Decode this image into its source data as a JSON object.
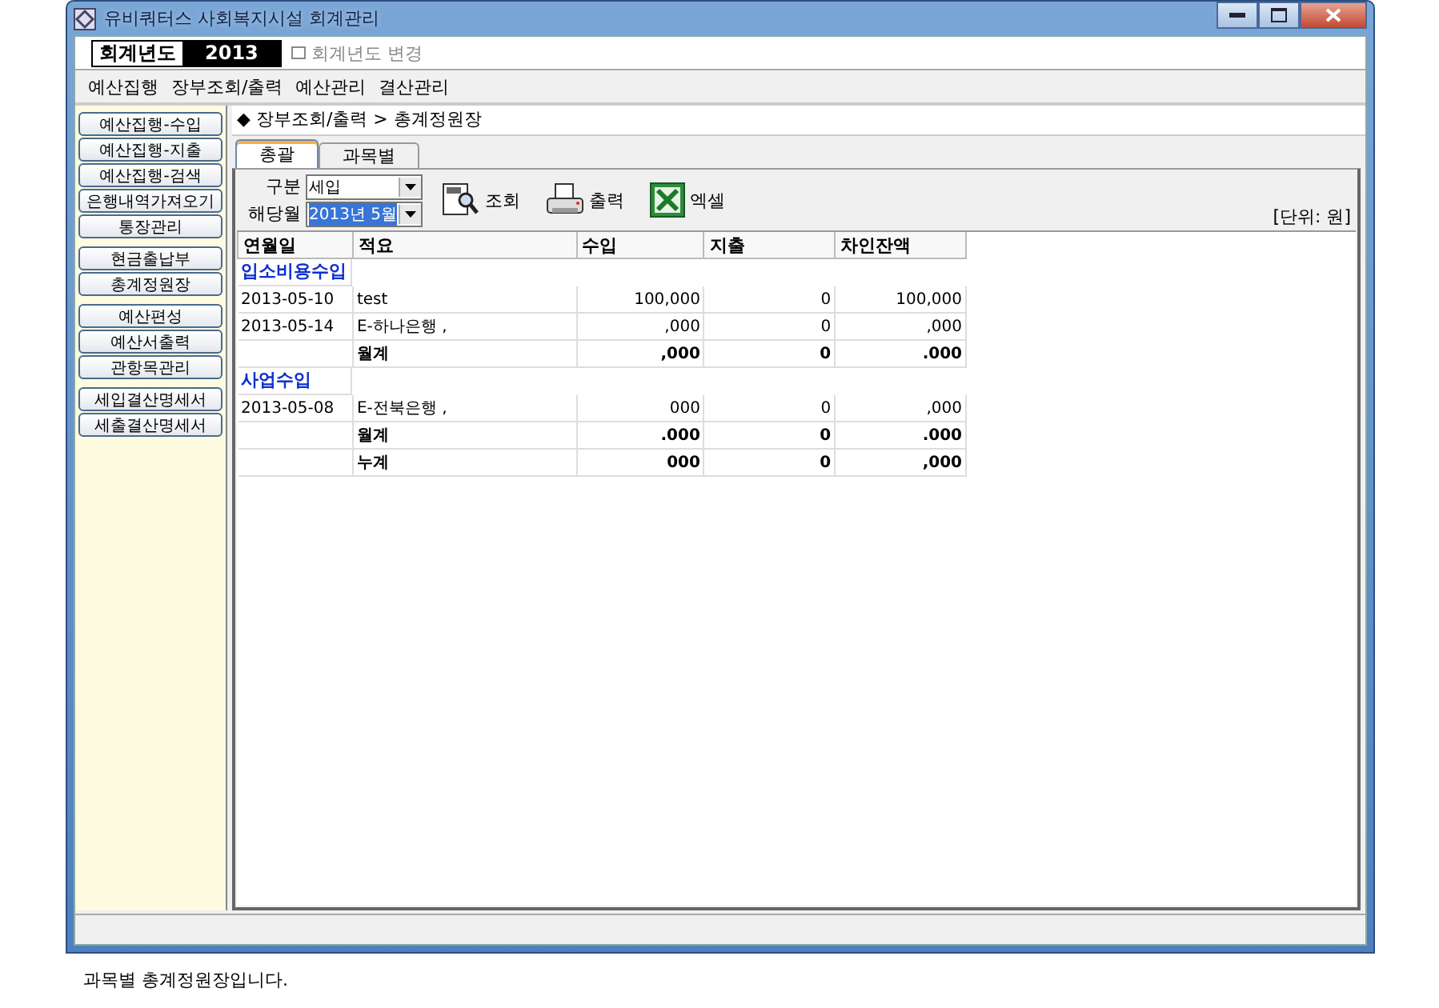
{
  "window": {
    "title": "유비쿼터스 사회복지시설 회계관리"
  },
  "fiscal_year": {
    "label": "회계년도",
    "value": "2013"
  },
  "change_year": {
    "label": "회계년도 변경"
  },
  "menu": [
    "예산집행",
    "장부조회/출력",
    "예산관리",
    "결산관리"
  ],
  "sidebar": {
    "groups": [
      [
        "예산집행-수입",
        "예산집행-지출",
        "예산집행-검색",
        "은행내역가져오기",
        "통장관리"
      ],
      [
        "현금출납부",
        "총계정원장"
      ],
      [
        "예산편성",
        "예산서출력",
        "관항목관리"
      ],
      [
        "세입결산명세서",
        "세출결산명세서"
      ]
    ]
  },
  "breadcrumb": "◆ 장부조회/출력 > 총계정원장",
  "tabs": [
    {
      "label": "총괄",
      "selected": true
    },
    {
      "label": "과목별",
      "selected": false
    }
  ],
  "filters": [
    {
      "label": "구분",
      "value": "세입",
      "highlighted": false
    },
    {
      "label": "해당월",
      "value": "2013년 5월",
      "highlighted": true
    }
  ],
  "toolbar": [
    {
      "kind": "search",
      "label": "조회"
    },
    {
      "kind": "print",
      "label": "출력"
    },
    {
      "kind": "excel",
      "label": "엑셀"
    }
  ],
  "unit": "[단위: 원]",
  "table": {
    "columns": [
      "연월일",
      "적요",
      "수입",
      "지출",
      "차인잔액"
    ],
    "rows": [
      {
        "kind": "group",
        "cells": [
          "입소비용수입"
        ]
      },
      {
        "kind": "entry",
        "cells": [
          "2013-05-10",
          "test",
          "100,000",
          "0",
          "100,000"
        ]
      },
      {
        "kind": "entry",
        "cells": [
          "2013-05-14",
          "E-하나은행 ,",
          ",000",
          "0",
          ",000"
        ]
      },
      {
        "kind": "total",
        "cells": [
          "",
          "월계",
          ",000",
          "0",
          ".000"
        ]
      },
      {
        "kind": "group",
        "cells": [
          "사업수입"
        ]
      },
      {
        "kind": "entry",
        "cells": [
          "2013-05-08",
          "E-전북은행 ,",
          "000",
          "0",
          ",000"
        ]
      },
      {
        "kind": "total",
        "cells": [
          "",
          "월계",
          ".000",
          "0",
          ".000"
        ]
      },
      {
        "kind": "total",
        "cells": [
          "",
          "누계",
          "000",
          "0",
          ",000"
        ]
      }
    ]
  },
  "caption": "과목별 총계정원장입니다."
}
